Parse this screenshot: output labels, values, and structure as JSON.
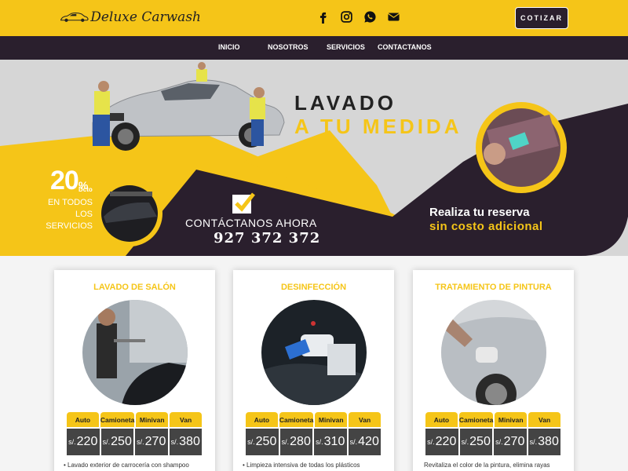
{
  "header": {
    "logo_text": "Deluxe Carwash",
    "cotizar_label": "COTIZAR",
    "socials": [
      "facebook-icon",
      "instagram-icon",
      "whatsapp-icon",
      "email-icon"
    ]
  },
  "nav": {
    "items": [
      "INICIO",
      "NOSOTROS",
      "SERVICIOS",
      "CONTACTANOS"
    ]
  },
  "hero": {
    "title_line1": "LAVADO",
    "title_line2": "A TU MEDIDA",
    "discount_pct": "20",
    "discount_sym": "%",
    "discount_dcto": "Dcto",
    "discount_lines": [
      "EN TODOS",
      "LOS",
      "SERVICIOS"
    ],
    "contact_label": "CONTÁCTANOS AHORA",
    "contact_phone": "927 372 372",
    "reserva_line1": "Realiza tu reserva",
    "reserva_line2": "sin costo adicional"
  },
  "colors": {
    "accent": "#f5c518",
    "dark": "#2a1f2d",
    "price_bg": "#444444"
  },
  "services": [
    {
      "title": "LAVADO DE SALÓN",
      "headers": [
        "Auto",
        "Camioneta",
        "Minivan",
        "Van"
      ],
      "currency": "s/.",
      "prices": [
        "220",
        "250",
        "270",
        "380"
      ],
      "description": "Lavado exterior de carrocería con shampoo"
    },
    {
      "title": "DESINFECCIÓN",
      "headers": [
        "Auto",
        "Camioneta",
        "Minivan",
        "Van"
      ],
      "currency": "s/.",
      "prices": [
        "250",
        "280",
        "310",
        "420"
      ],
      "description": "Limpieza intensiva de todas los plásticos"
    },
    {
      "title": "TRATAMIENTO DE PINTURA",
      "headers": [
        "Auto",
        "Camioneta",
        "Minivan",
        "Van"
      ],
      "currency": "s/.",
      "prices": [
        "220",
        "250",
        "270",
        "380"
      ],
      "description": "Revitaliza el color de la pintura, elimina rayas ligeras y"
    }
  ]
}
